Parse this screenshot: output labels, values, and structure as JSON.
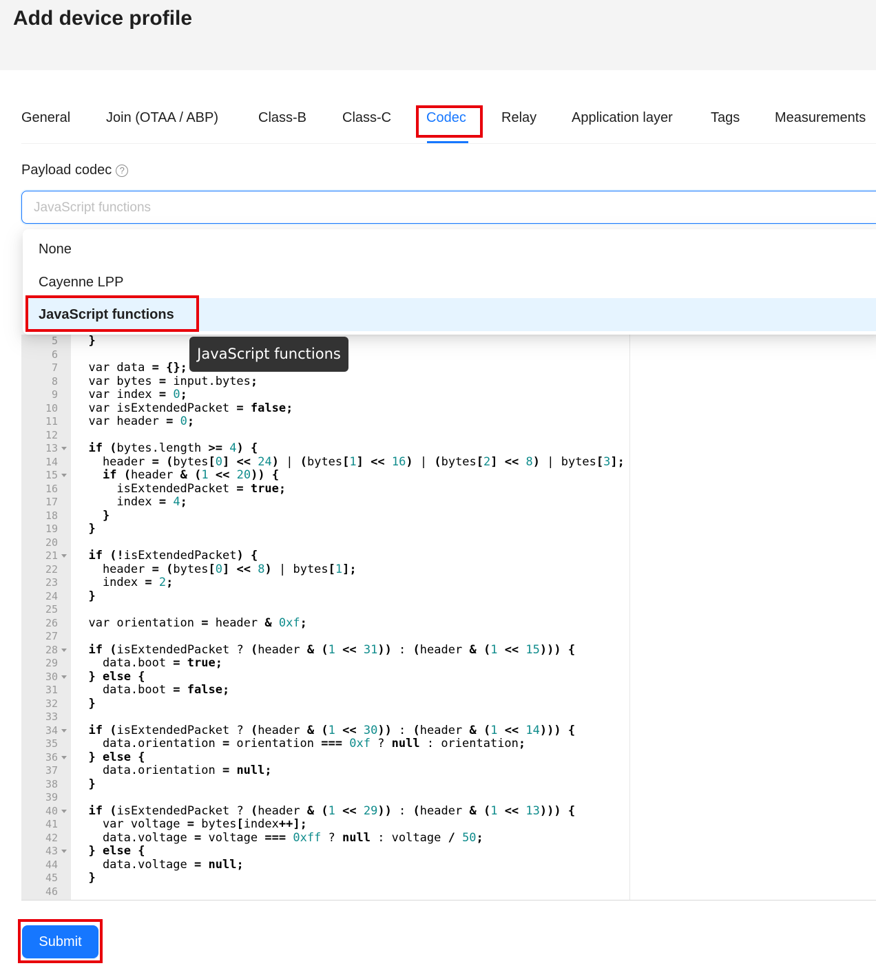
{
  "page": {
    "title": "Add device profile"
  },
  "tabs": [
    {
      "label": "General"
    },
    {
      "label": "Join (OTAA / ABP)"
    },
    {
      "label": "Class-B"
    },
    {
      "label": "Class-C"
    },
    {
      "label": "Codec",
      "active": true
    },
    {
      "label": "Relay"
    },
    {
      "label": "Application layer"
    },
    {
      "label": "Tags"
    },
    {
      "label": "Measurements"
    }
  ],
  "form": {
    "payload_codec_label": "Payload codec",
    "help_icon": "question-circle-icon",
    "select_placeholder": "JavaScript functions",
    "options": [
      {
        "label": "None"
      },
      {
        "label": "Cayenne LPP"
      },
      {
        "label": "JavaScript functions",
        "selected": true
      }
    ]
  },
  "tooltip": {
    "text": "JavaScript functions"
  },
  "editor": {
    "lines": [
      {
        "n": "5",
        "text": "  }"
      },
      {
        "n": "6",
        "text": ""
      },
      {
        "n": "7",
        "text": "  var data = {};"
      },
      {
        "n": "8",
        "text": "  var bytes = input.bytes;"
      },
      {
        "n": "9",
        "text": "  var index = 0;"
      },
      {
        "n": "10",
        "text": "  var isExtendedPacket = false;"
      },
      {
        "n": "11",
        "text": "  var header = 0;"
      },
      {
        "n": "12",
        "text": ""
      },
      {
        "n": "13",
        "text": "  if (bytes.length >= 4) {",
        "fold": true
      },
      {
        "n": "14",
        "text": "    header = (bytes[0] << 24) | (bytes[1] << 16) | (bytes[2] << 8) | bytes[3];"
      },
      {
        "n": "15",
        "text": "    if (header & (1 << 20)) {",
        "fold": true
      },
      {
        "n": "16",
        "text": "      isExtendedPacket = true;"
      },
      {
        "n": "17",
        "text": "      index = 4;"
      },
      {
        "n": "18",
        "text": "    }"
      },
      {
        "n": "19",
        "text": "  }"
      },
      {
        "n": "20",
        "text": ""
      },
      {
        "n": "21",
        "text": "  if (!isExtendedPacket) {",
        "fold": true
      },
      {
        "n": "22",
        "text": "    header = (bytes[0] << 8) | bytes[1];"
      },
      {
        "n": "23",
        "text": "    index = 2;"
      },
      {
        "n": "24",
        "text": "  }"
      },
      {
        "n": "25",
        "text": ""
      },
      {
        "n": "26",
        "text": "  var orientation = header & 0xf;"
      },
      {
        "n": "27",
        "text": ""
      },
      {
        "n": "28",
        "text": "  if (isExtendedPacket ? (header & (1 << 31)) : (header & (1 << 15))) {",
        "fold": true
      },
      {
        "n": "29",
        "text": "    data.boot = true;"
      },
      {
        "n": "30",
        "text": "  } else {",
        "fold": true
      },
      {
        "n": "31",
        "text": "    data.boot = false;"
      },
      {
        "n": "32",
        "text": "  }"
      },
      {
        "n": "33",
        "text": ""
      },
      {
        "n": "34",
        "text": "  if (isExtendedPacket ? (header & (1 << 30)) : (header & (1 << 14))) {",
        "fold": true
      },
      {
        "n": "35",
        "text": "    data.orientation = orientation === 0xf ? null : orientation;"
      },
      {
        "n": "36",
        "text": "  } else {",
        "fold": true
      },
      {
        "n": "37",
        "text": "    data.orientation = null;"
      },
      {
        "n": "38",
        "text": "  }"
      },
      {
        "n": "39",
        "text": ""
      },
      {
        "n": "40",
        "text": "  if (isExtendedPacket ? (header & (1 << 29)) : (header & (1 << 13))) {",
        "fold": true
      },
      {
        "n": "41",
        "text": "    var voltage = bytes[index++];"
      },
      {
        "n": "42",
        "text": "    data.voltage = voltage === 0xff ? null : voltage / 50;"
      },
      {
        "n": "43",
        "text": "  } else {",
        "fold": true
      },
      {
        "n": "44",
        "text": "    data.voltage = null;"
      },
      {
        "n": "45",
        "text": "  }"
      },
      {
        "n": "46",
        "text": ""
      }
    ]
  },
  "actions": {
    "submit_label": "Submit"
  },
  "colors": {
    "accent": "#1677ff",
    "highlight": "#e8000b",
    "selected_option_bg": "#e6f4ff"
  }
}
